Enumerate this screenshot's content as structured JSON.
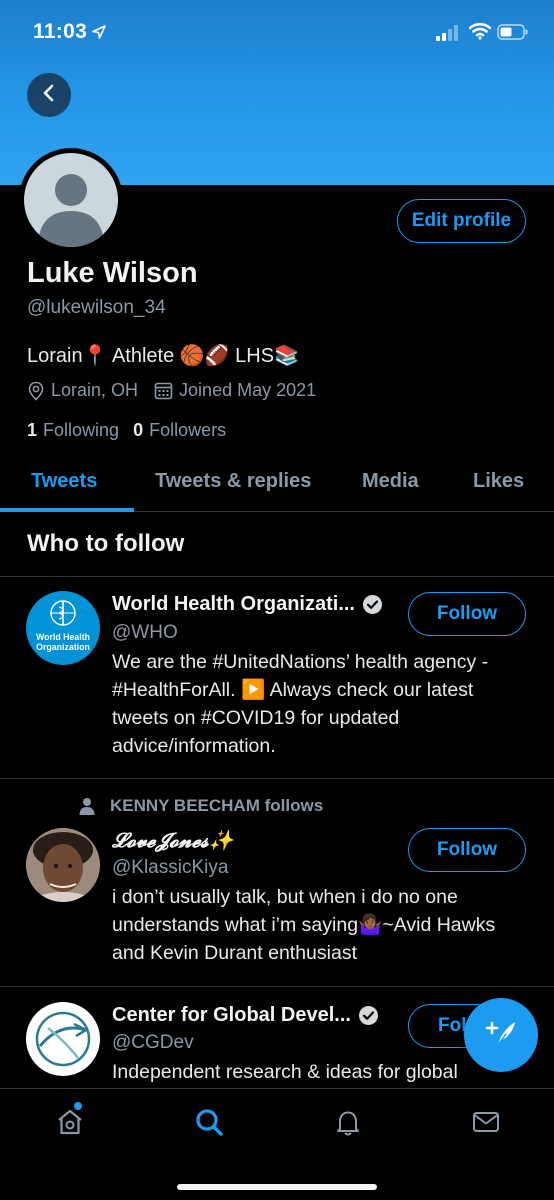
{
  "status_bar": {
    "time": "11:03"
  },
  "profile": {
    "name": "Luke Wilson",
    "handle": "@lukewilson_34",
    "bio": "Lorain📍 Athlete 🏀🏈 LHS📚",
    "location": "Lorain, OH",
    "joined": "Joined May 2021",
    "following_count": "1",
    "following_label": "Following",
    "followers_count": "0",
    "followers_label": "Followers",
    "edit_label": "Edit profile"
  },
  "tabs": [
    {
      "label": "Tweets",
      "active": true
    },
    {
      "label": "Tweets & replies",
      "active": false
    },
    {
      "label": "Media",
      "active": false
    },
    {
      "label": "Likes",
      "active": false
    }
  ],
  "who_to_follow": {
    "title": "Who to follow",
    "follow_label": "Follow",
    "items": [
      {
        "name": "World Health Organizati...",
        "verified": true,
        "handle": "@WHO",
        "avatar_text": [
          "World Health",
          "Organization"
        ],
        "bio": "We are the #UnitedNations’ health agency - #HealthForAll. ▶️ Always check our latest tweets on #COVID19 for updated advice/information."
      },
      {
        "context": "KENNY BEECHAM follows",
        "name": "𝓛𝓸𝓿𝓮𝓙𝓸𝓷𝓮𝓼✨",
        "verified": false,
        "handle": "@KlassicKiya",
        "bio": "i don’t usually talk, but when i do no one understands what i’m saying🤷🏾‍♀️~Avid Hawks and Kevin Durant enthusiast"
      },
      {
        "name": "Center for Global Devel...",
        "verified": true,
        "handle": "@CGDev",
        "follow_visible": "Fol",
        "bio": "Independent research & ideas for global"
      }
    ]
  },
  "colors": {
    "accent": "#1d9bf0",
    "banner": "#2597e8",
    "background": "#000000",
    "muted": "#8b98a5"
  }
}
